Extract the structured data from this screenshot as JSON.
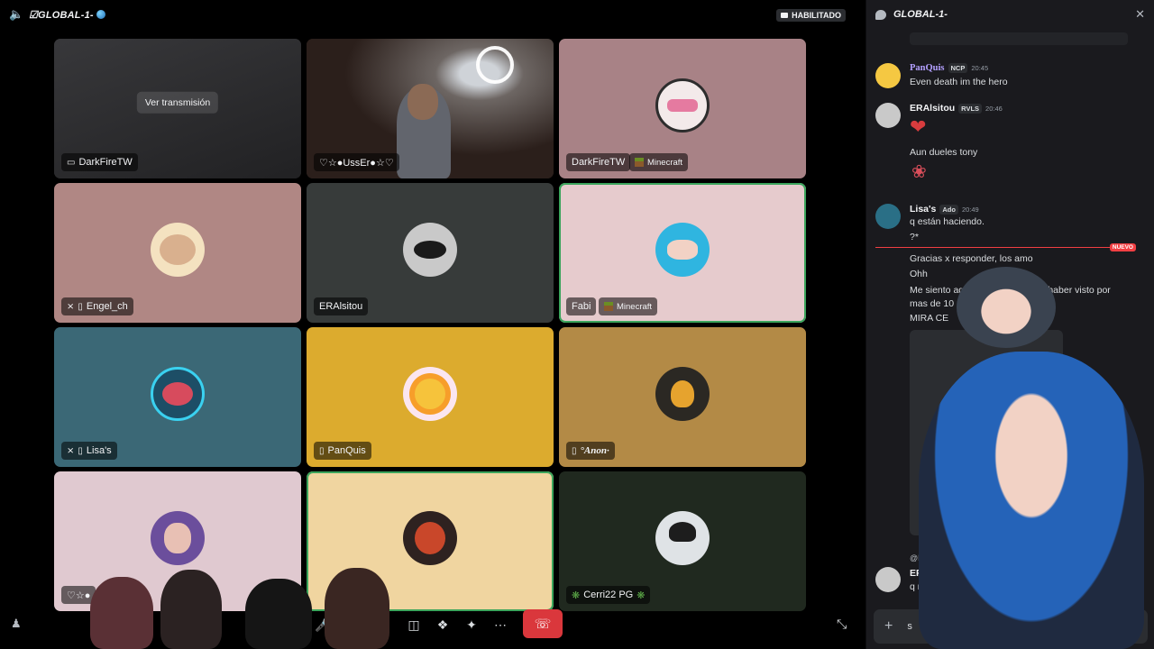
{
  "call": {
    "channel": "☑⁠GLOBAL-1-",
    "status_badge": "HABILITADO",
    "tiles": [
      {
        "name": "DarkFireTW",
        "stream_label": "Ver transmisión",
        "bg": "#2a2a2c"
      },
      {
        "name": "♡☆●UssEr●☆♡",
        "bg": "#3a2a26"
      },
      {
        "name": "DarkFireTW",
        "game": "Minecraft",
        "bg": "#a88286"
      },
      {
        "name": "Engel_ch",
        "bg": "#b08784"
      },
      {
        "name": "ERAlsitou",
        "bg": "#373b3a"
      },
      {
        "name": "Fabi",
        "game": "Minecraft",
        "bg": "#e6cbcd"
      },
      {
        "name": "Lisa's",
        "bg": "#3b6876"
      },
      {
        "name": "PanQuis",
        "bg": "#dcab2e"
      },
      {
        "name": "°Anon·",
        "bg": "#b38a46"
      },
      {
        "name": "♡☆●",
        "bg": "#e0c9d0"
      },
      {
        "name": "",
        "bg": "#f0d5a0"
      },
      {
        "name": "Cerri22 PG",
        "bg": "#20291f"
      }
    ]
  },
  "chat": {
    "title": "GLOBAL-1-",
    "messages": [
      {
        "author": "PanQuis",
        "tag": "NCP",
        "time": "20:45",
        "lines": [
          "Even death im the hero"
        ]
      },
      {
        "author": "ERAlsitou",
        "tag": "RVLS",
        "time": "20:46",
        "lines": [
          "Aun dueles tony"
        ]
      },
      {
        "author": "Lisa's",
        "tag": "Ado",
        "time": "20:49",
        "lines": [
          "q están haciendo.",
          "?*"
        ]
      },
      {
        "lines": [
          "Gracias x responder, los amo",
          "Ohh",
          "Me siento aqui to",
          "sin haber visto por",
          "mas de 10 m",
          "MIRA CE"
        ]
      },
      {
        "author": "ERAlsitou",
        "reply": "@Lisa's",
        "lines": [
          "q rico mque"
        ]
      }
    ],
    "new_label": "NUEVO",
    "composer_value": "s"
  }
}
